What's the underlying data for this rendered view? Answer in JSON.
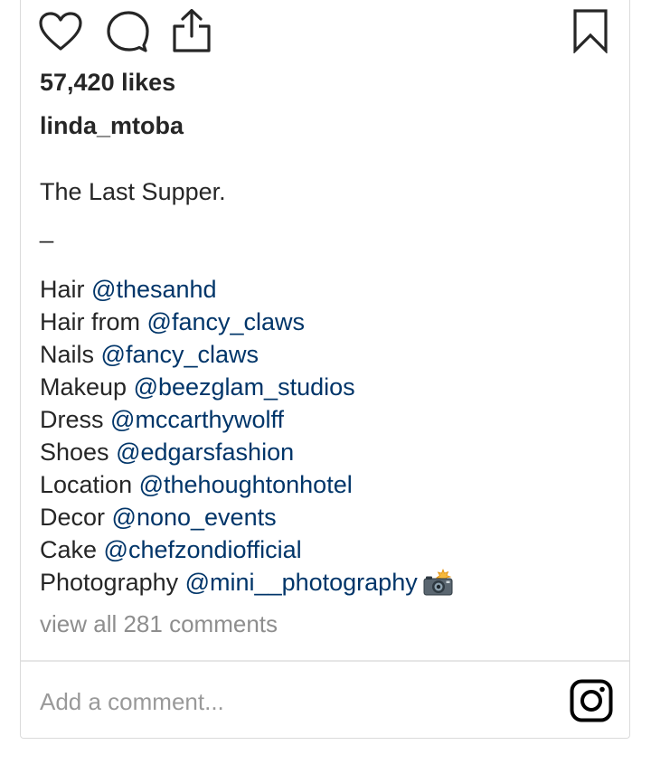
{
  "actions": {
    "like_icon": "heart-outline",
    "comment_icon": "speech-bubble",
    "share_icon": "upload-share",
    "bookmark_icon": "bookmark-outline"
  },
  "post": {
    "likes_text": "57,420 likes",
    "username": "linda_mtoba",
    "caption_title": "The Last Supper.",
    "caption_separator": "_",
    "credits": [
      {
        "label": "Hair",
        "handle": "@thesanhd"
      },
      {
        "label": "Hair from",
        "handle": "@fancy_claws"
      },
      {
        "label": "Nails",
        "handle": "@fancy_claws"
      },
      {
        "label": "Makeup",
        "handle": "@beezglam_studios"
      },
      {
        "label": "Dress",
        "handle": "@mccarthywolff"
      },
      {
        "label": "Shoes",
        "handle": "@edgarsfashion"
      },
      {
        "label": "Location",
        "handle": "@thehoughtonhotel"
      },
      {
        "label": "Decor",
        "handle": "@nono_events"
      },
      {
        "label": "Cake",
        "handle": "@chefzondiofficial"
      },
      {
        "label": "Photography",
        "handle": "@mini__photography",
        "emoji": "camera-with-flash"
      }
    ],
    "view_comments_text": "view all 281 comments"
  },
  "comment_box": {
    "placeholder": "Add a comment...",
    "value": ""
  },
  "colors": {
    "text": "#262626",
    "mention": "#003569",
    "muted": "#8e8e8e",
    "border": "#dbdbdb"
  }
}
